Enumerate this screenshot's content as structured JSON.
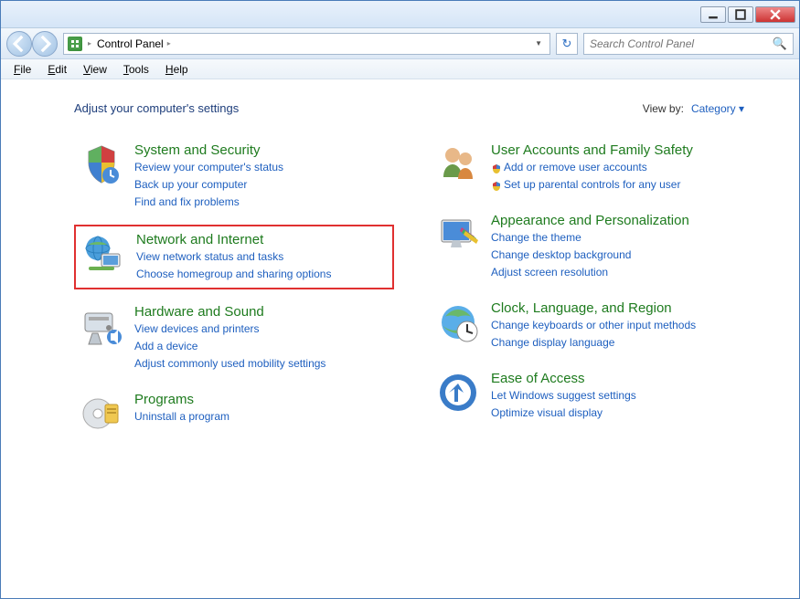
{
  "breadcrumb": {
    "item": "Control Panel"
  },
  "search": {
    "placeholder": "Search Control Panel"
  },
  "menu": {
    "file": "File",
    "edit": "Edit",
    "view": "View",
    "tools": "Tools",
    "help": "Help"
  },
  "header": {
    "title": "Adjust your computer's settings",
    "view_by_label": "View by:",
    "view_by_value": "Category"
  },
  "categories": {
    "left": [
      {
        "title": "System and Security",
        "links": [
          "Review your computer's status",
          "Back up your computer",
          "Find and fix problems"
        ],
        "highlighted": false
      },
      {
        "title": "Network and Internet",
        "links": [
          "View network status and tasks",
          "Choose homegroup and sharing options"
        ],
        "highlighted": true
      },
      {
        "title": "Hardware and Sound",
        "links": [
          "View devices and printers",
          "Add a device",
          "Adjust commonly used mobility settings"
        ],
        "highlighted": false
      },
      {
        "title": "Programs",
        "links": [
          "Uninstall a program"
        ],
        "highlighted": false
      }
    ],
    "right": [
      {
        "title": "User Accounts and Family Safety",
        "links": [
          "Add or remove user accounts",
          "Set up parental controls for any user"
        ],
        "shields": [
          true,
          true
        ],
        "highlighted": false
      },
      {
        "title": "Appearance and Personalization",
        "links": [
          "Change the theme",
          "Change desktop background",
          "Adjust screen resolution"
        ],
        "highlighted": false
      },
      {
        "title": "Clock, Language, and Region",
        "links": [
          "Change keyboards or other input methods",
          "Change display language"
        ],
        "highlighted": false
      },
      {
        "title": "Ease of Access",
        "links": [
          "Let Windows suggest settings",
          "Optimize visual display"
        ],
        "highlighted": false
      }
    ]
  }
}
